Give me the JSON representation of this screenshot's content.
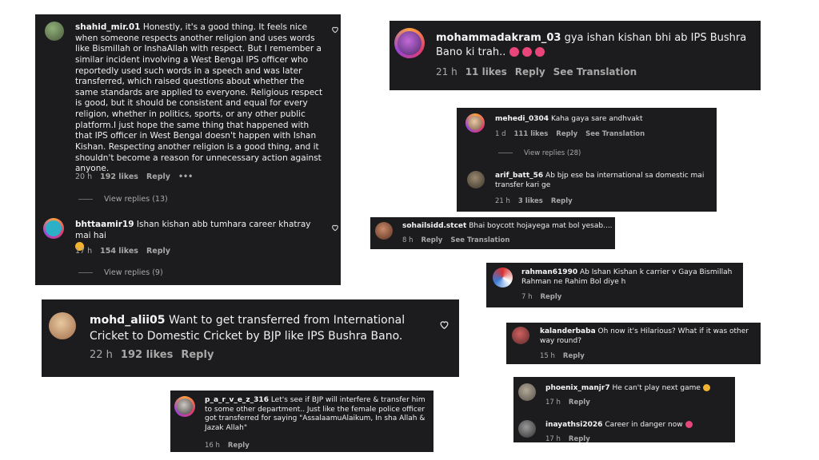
{
  "c1": {
    "user": "shahid_mir.01",
    "text": "Honestly, it's a good thing. It feels nice when someone respects another religion and uses words like Bismillah or InshaAllah with respect. But I remember a similar incident involving a West Bengal IPS officer who reportedly used such words in a speech and was later transferred, which raised questions about whether the same standards are applied to everyone. Religious respect is good, but it should be consistent and equal for every religion, whether in politics, sports, or any other public platform.I just hope the same thing that happened with that IPS officer in West Bengal doesn't happen with Ishan Kishan. Respecting another religion is a good thing, and it shouldn't become a reason for unnecessary action against anyone.",
    "time": "20 h",
    "likes": "192 likes",
    "reply": "Reply",
    "more": "•••",
    "view_replies": "View replies (13)",
    "reply_user": "bhttaamir19",
    "reply_text": "Ishan kishan abb tumhara career khatray mai hai",
    "reply_time": "17 h",
    "reply_likes": "154 likes",
    "reply_reply": "Reply",
    "reply_view_replies": "View replies (9)"
  },
  "c2": {
    "user": "mohammadakram_03",
    "text": "gya ishan kishan bhi ab IPS Bushra Bano ki trah..",
    "time": "21 h",
    "likes": "11 likes",
    "reply": "Reply",
    "translate": "See Translation"
  },
  "c3": {
    "user": "mehedi_0304",
    "text": "Kaha gaya sare andhvakt",
    "time": "1 d",
    "likes": "111 likes",
    "reply": "Reply",
    "translate": "See Translation",
    "view_replies": "View replies (28)",
    "reply_user": "arif_batt_56",
    "reply_text": "Ab bjp ese ba international sa domestic mai transfer kari ge",
    "reply_time": "21 h",
    "reply_likes": "3 likes",
    "reply_reply": "Reply"
  },
  "c4": {
    "user": "sohailsidd.stcet",
    "text": "Bhai boycott hojayega mat bol yesab....",
    "time": "8 h",
    "reply": "Reply",
    "translate": "See Translation"
  },
  "c5": {
    "user": "rahman61990",
    "text": "Ab Ishan Kishan k carrier v Gaya Bismillah Rahman ne Rahim Bol diye h",
    "time": "7 h",
    "reply": "Reply"
  },
  "c6": {
    "user": "mohd_alii05",
    "text": "Want to get transferred from International Cricket to Domestic Cricket by BJP like IPS Bushra Bano.",
    "time": "22 h",
    "likes": "192 likes",
    "reply": "Reply"
  },
  "c7": {
    "user": "kalanderbaba",
    "text": "Oh now it's Hilarious? What if it was other way round?",
    "time": "15 h",
    "reply": "Reply"
  },
  "c8": {
    "user": "p_a_r_v_e_z_316",
    "text": "Let's see if BJP will interfere & transfer him to some other department.. Just like the female police officer got transferred for saying \"AssalaamuAlaikum, In sha Allah & Jazak Allah\"",
    "time": "16 h",
    "reply": "Reply"
  },
  "c9": {
    "user": "phoenix_manjr7",
    "text": "He can't play next game",
    "time": "17 h",
    "reply": "Reply",
    "user2": "inayathsi2026",
    "text2": "Career in danger now",
    "time2": "17 h",
    "reply2": "Reply"
  },
  "colors": {
    "card": "#1c1c1e",
    "meta": "#a8a8a8",
    "emoji": "#f2b430"
  }
}
